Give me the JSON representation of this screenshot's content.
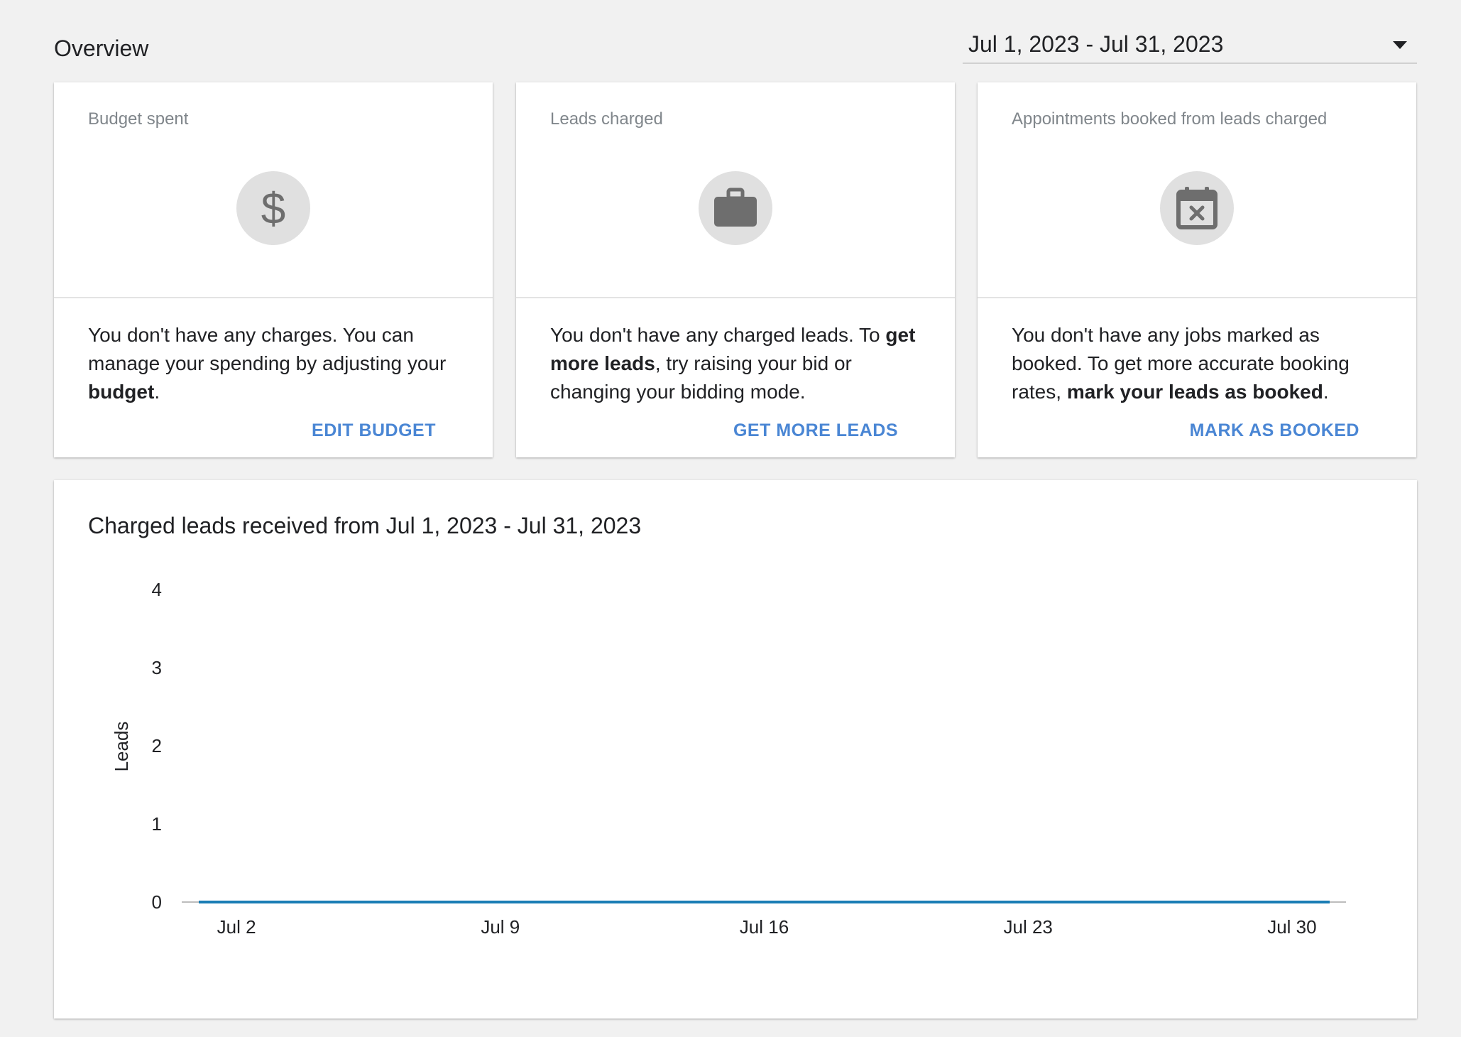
{
  "header": {
    "title": "Overview",
    "date_range": "Jul 1, 2023 - Jul 31, 2023"
  },
  "cards": [
    {
      "title": "Budget spent",
      "icon": "dollar-icon",
      "body_parts": [
        "You don't have any charges. You can manage your spending by adjusting your ",
        "budget",
        "."
      ],
      "action": "EDIT BUDGET"
    },
    {
      "title": "Leads charged",
      "icon": "briefcase-icon",
      "body_parts": [
        "You don't have any charged leads. To ",
        "get more leads",
        ", try raising your bid or changing your bidding mode."
      ],
      "action": "GET MORE LEADS"
    },
    {
      "title": "Appointments booked from leads charged",
      "icon": "calendar-x-icon",
      "body_parts": [
        "You don't have any jobs marked as booked. To get more accurate booking rates, ",
        "mark your leads as booked",
        "."
      ],
      "action": "MARK AS BOOKED"
    }
  ],
  "chart_title": "Charged leads received from Jul 1, 2023 - Jul 31, 2023",
  "chart_data": {
    "type": "line",
    "title": "Charged leads received from Jul 1, 2023 - Jul 31, 2023",
    "xlabel": "",
    "ylabel": "Leads",
    "ylim": [
      0,
      4
    ],
    "yticks": [
      "0",
      "1",
      "2",
      "3",
      "4"
    ],
    "x_tick_labels": [
      "Jul 2",
      "Jul 9",
      "Jul 16",
      "Jul 23",
      "Jul 30"
    ],
    "x_tick_days": [
      2,
      9,
      16,
      23,
      30
    ],
    "x": [
      "Jul 1",
      "Jul 2",
      "Jul 3",
      "Jul 4",
      "Jul 5",
      "Jul 6",
      "Jul 7",
      "Jul 8",
      "Jul 9",
      "Jul 10",
      "Jul 11",
      "Jul 12",
      "Jul 13",
      "Jul 14",
      "Jul 15",
      "Jul 16",
      "Jul 17",
      "Jul 18",
      "Jul 19",
      "Jul 20",
      "Jul 21",
      "Jul 22",
      "Jul 23",
      "Jul 24",
      "Jul 25",
      "Jul 26",
      "Jul 27",
      "Jul 28",
      "Jul 29",
      "Jul 30",
      "Jul 31"
    ],
    "series": [
      {
        "values": [
          0,
          0,
          0,
          0,
          0,
          0,
          0,
          0,
          0,
          0,
          0,
          0,
          0,
          0,
          0,
          0,
          0,
          0,
          0,
          0,
          0,
          0,
          0,
          0,
          0,
          0,
          0,
          0,
          0,
          0,
          0
        ]
      }
    ],
    "line_color": "#1a7db5",
    "grid": false,
    "legend": "none"
  }
}
